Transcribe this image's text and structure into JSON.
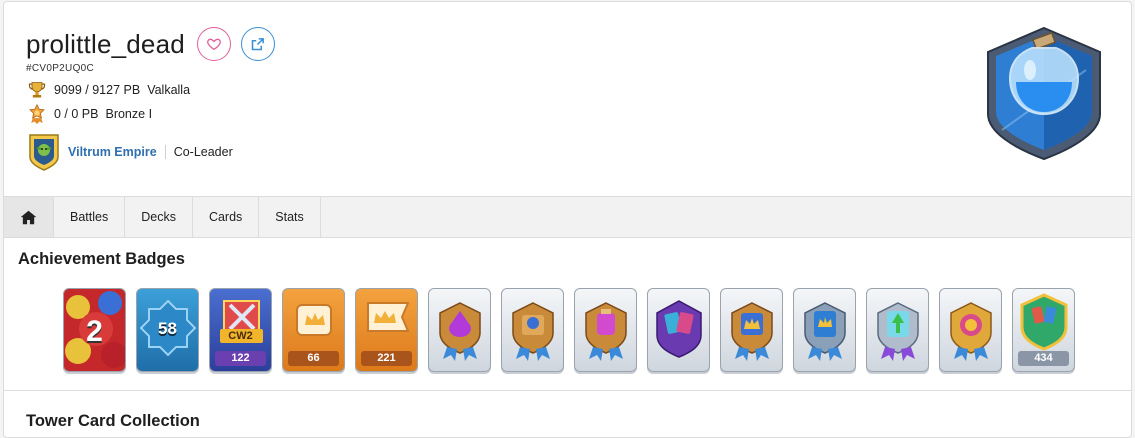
{
  "profile": {
    "name": "prolittle_dead",
    "tag": "#CV0P2UQ0C",
    "trophies": "9099 / 9127 PB",
    "trophy_league": "Valkalla",
    "ranked": "0 / 0 PB",
    "ranked_league": "Bronze I",
    "clan_name": "Viltrum Empire",
    "clan_role": "Co-Leader"
  },
  "tabs": [
    {
      "label": "",
      "icon": "home-icon"
    },
    {
      "label": "Battles"
    },
    {
      "label": "Decks"
    },
    {
      "label": "Cards"
    },
    {
      "label": "Stats"
    }
  ],
  "achievements": {
    "title": "Achievement Badges",
    "badges": [
      {
        "icon": "years-played-badge",
        "value": "2"
      },
      {
        "icon": "level-badge",
        "value": "58"
      },
      {
        "icon": "clan-wars-2-badge",
        "value": "122",
        "sub": "CW2"
      },
      {
        "icon": "cards-collected-badge",
        "value": "66"
      },
      {
        "icon": "crown-banner-badge",
        "value": "221"
      },
      {
        "icon": "elixir-badge"
      },
      {
        "icon": "king-tower-badge"
      },
      {
        "icon": "potion-badge"
      },
      {
        "icon": "cards-purple-badge"
      },
      {
        "icon": "crowns-badge"
      },
      {
        "icon": "crown-card-badge"
      },
      {
        "icon": "evolution-badge"
      },
      {
        "icon": "gold-medal-badge"
      },
      {
        "icon": "collection-badge",
        "value": "434"
      }
    ]
  },
  "tower": {
    "title": "Tower Card Collection"
  },
  "colors": {
    "accent_blue": "#2f6fb0",
    "favorite_pink": "#e0609b",
    "link_blue": "#3a8fd6"
  }
}
